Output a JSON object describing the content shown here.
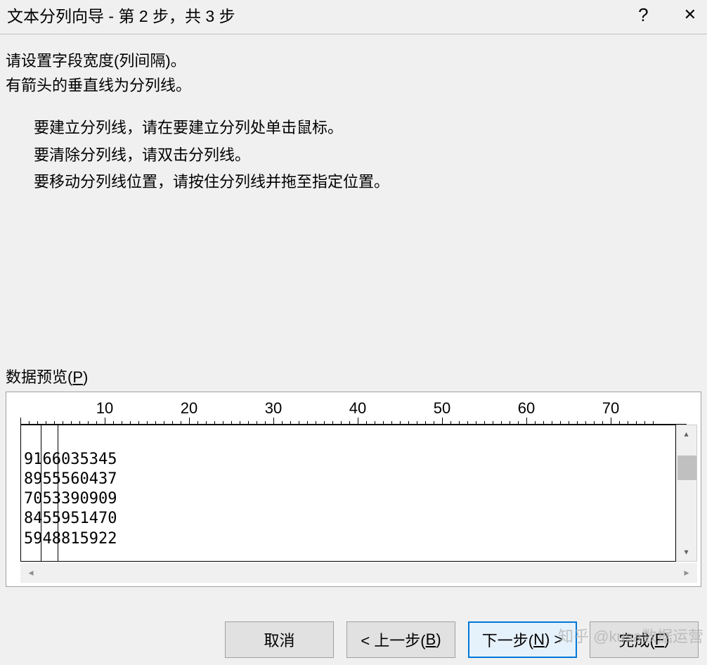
{
  "titlebar": {
    "title": "文本分列向导 - 第 2 步，共 3 步",
    "help": "?",
    "close": "✕"
  },
  "instructions": {
    "line1": "请设置字段宽度(列间隔)。",
    "line2": "有箭头的垂直线为分列线。",
    "sub1": "要建立分列线，请在要建立分列处单击鼠标。",
    "sub2": "要清除分列线，请双击分列线。",
    "sub3": "要移动分列线位置，请按住分列线并拖至指定位置。"
  },
  "preview": {
    "label_prefix": "数据预览(",
    "label_key": "P",
    "label_suffix": ")",
    "ruler_ticks": [
      "10",
      "20",
      "30",
      "40",
      "50",
      "60",
      "70"
    ],
    "break_positions": [
      2,
      4
    ],
    "rows": [
      "9166035345",
      "8955560437",
      "7053390909",
      "8455951470",
      "5948815922"
    ]
  },
  "buttons": {
    "cancel": "取消",
    "back_prefix": "< 上一步(",
    "back_key": "B",
    "back_suffix": ")",
    "next_prefix": "下一步(",
    "next_key": "N",
    "next_suffix": ") >",
    "finish_prefix": "完成(",
    "finish_key": "F",
    "finish_suffix": ")"
  },
  "watermark": "知乎 @kusa数据运营",
  "ruler": {
    "char_width": 12,
    "tick_interval": 10,
    "max": 75
  }
}
